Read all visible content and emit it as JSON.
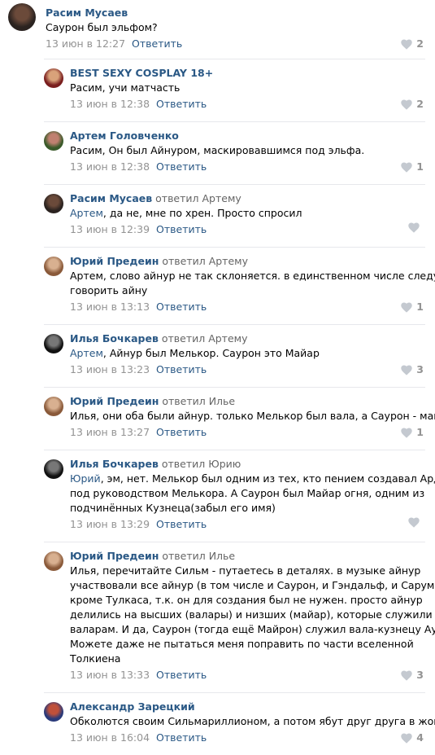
{
  "labels": {
    "reply": "Ответить",
    "replied_prefix": "ответил"
  },
  "comments": [
    {
      "author": "Расим Мусаев",
      "replied_to": "",
      "mention": "",
      "text": "Саурон был эльфом?",
      "time": "13 июн в 12:27",
      "likes": "2",
      "avatar_colors": [
        "#2b2320",
        "#6b4a3a"
      ]
    },
    {
      "author": "BEST SEXY COSPLAY 18+",
      "replied_to": "",
      "mention": "",
      "text": "Расим, учи матчасть",
      "time": "13 июн в 12:38",
      "likes": "2",
      "avatar_colors": [
        "#7a1f1f",
        "#d9a27a"
      ]
    },
    {
      "author": "Артем Головченко",
      "replied_to": "",
      "mention": "",
      "text": "Расим, Он был Айнуром, маскировавшимся под эльфа.",
      "time": "13 июн в 12:38",
      "likes": "1",
      "avatar_colors": [
        "#3a5a2a",
        "#c08070"
      ]
    },
    {
      "author": "Расим Мусаев",
      "replied_to": "ответил Артему",
      "mention": "Артем",
      "text": ", да не, мне по хрен. Просто спросил",
      "time": "13 июн в 12:39",
      "likes": "",
      "avatar_colors": [
        "#2b2320",
        "#6b4a3a"
      ]
    },
    {
      "author": "Юрий Предеин",
      "replied_to": "ответил Артему",
      "mention": "",
      "text": "Артем, слово айнур не так склоняется. в единственном числе следует\nговорить айну",
      "time": "13 июн в 13:13",
      "likes": "1",
      "avatar_colors": [
        "#8a5a3a",
        "#d8b090"
      ]
    },
    {
      "author": "Илья Бочкарев",
      "replied_to": "ответил Артему",
      "mention": "Артем",
      "text": ", Айнур был Мелькор. Саурон это Майар",
      "time": "13 июн в 13:23",
      "likes": "3",
      "avatar_colors": [
        "#111111",
        "#777777"
      ]
    },
    {
      "author": "Юрий Предеин",
      "replied_to": "ответил Илье",
      "mention": "",
      "text": "Илья, они оба были айнур. только Мелькор был вала, а Саурон - майа",
      "time": "13 июн в 13:27",
      "likes": "1",
      "avatar_colors": [
        "#8a5a3a",
        "#d8b090"
      ]
    },
    {
      "author": "Илья Бочкарев",
      "replied_to": "ответил Юрию",
      "mention": "Юрий",
      "text": ", эм, нет. Мелькор был одним из тех, кто пением создавал Арду\nпод руководством Мелькора. А Саурон был Майар огня, одним из\nподчинённых Кузнеца(забыл его имя)",
      "time": "13 июн в 13:29",
      "likes": "",
      "avatar_colors": [
        "#111111",
        "#777777"
      ]
    },
    {
      "author": "Юрий Предеин",
      "replied_to": "ответил Илье",
      "mention": "",
      "text": "Илья, перечитайте Сильм - путаетесь в деталях. в музыке айнур\nучаствовали все айнур (в том числе и Саурон, и Гэндальф, и Саруман)\nкроме Тулкаса, т.к. он для создания был не нужен. просто айнур\nделились на высших (валары) и низших (майар), которые служили\nваларам. И да, Саурон (тогда ещё Майрон) служил вала-кузнецу Ауле.\nМожете даже не пытаться меня поправить по части вселенной\nТолкиена",
      "time": "13 июн в 13:33",
      "likes": "3",
      "avatar_colors": [
        "#8a5a3a",
        "#d8b090"
      ]
    },
    {
      "author": "Александр Зарецкий",
      "replied_to": "",
      "mention": "",
      "text": "Обколются своим Сильмариллионом, а потом ябут друг друга в жопы!",
      "time": "13 июн в 16:04",
      "likes": "4",
      "avatar_colors": [
        "#2a3a7a",
        "#c0503a"
      ]
    }
  ]
}
